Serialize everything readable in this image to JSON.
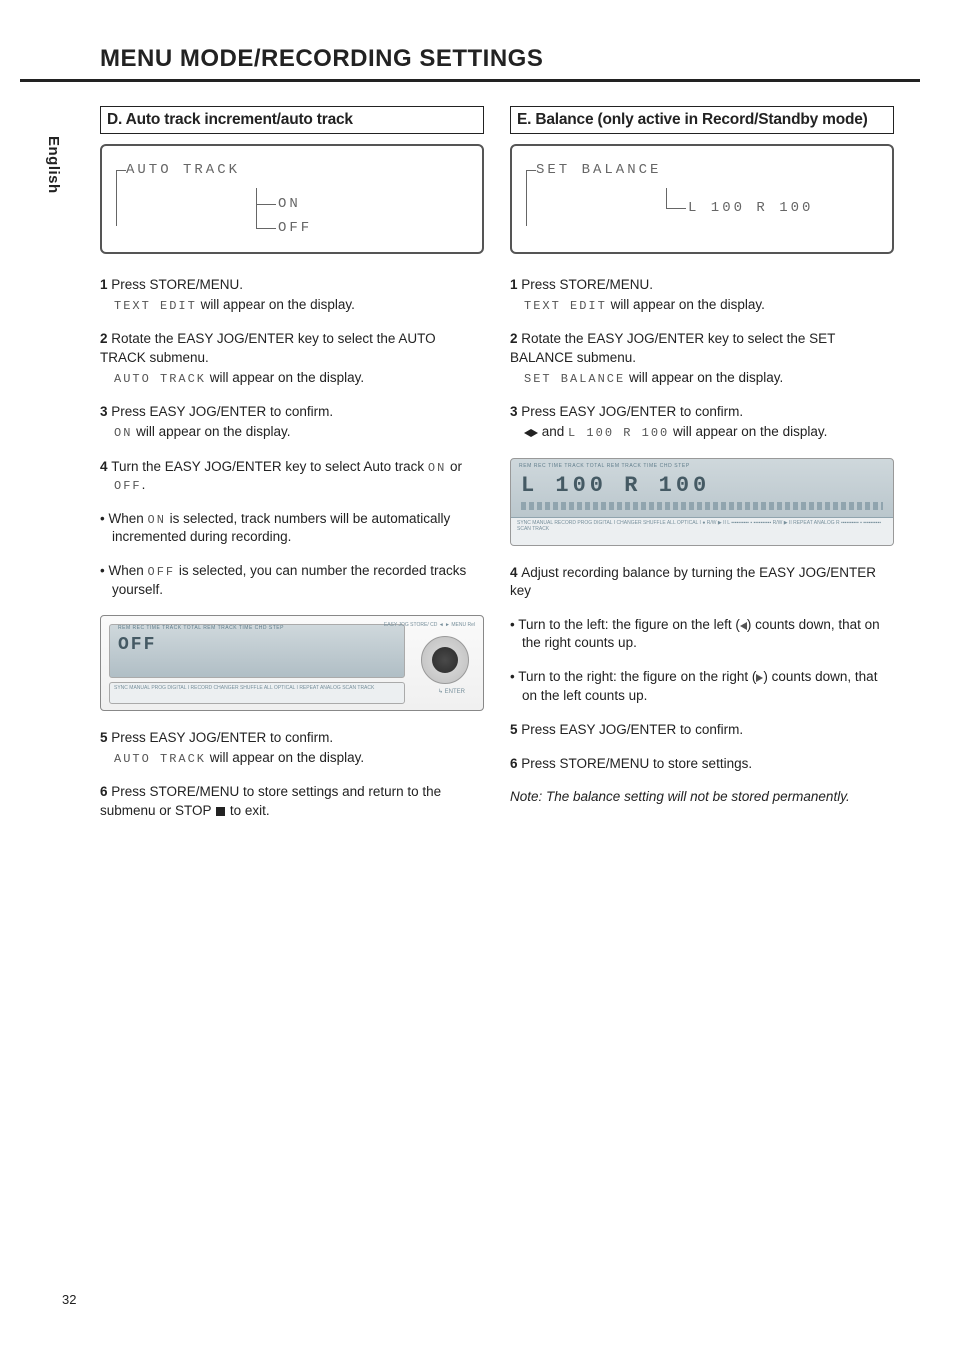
{
  "page": {
    "language_tab": "English",
    "title": "MENU MODE/RECORDING SETTINGS",
    "page_number": "32"
  },
  "left": {
    "section_title": "D. Auto track increment/auto track",
    "display": {
      "top_label": "AUTO TRACK",
      "opt_on": "ON",
      "opt_off": "OFF"
    },
    "steps": {
      "s1_a": "Press STORE/MENU.",
      "s1_b_pre": "TEXT EDIT",
      "s1_b_post": " will appear on the display.",
      "s2_a": "Rotate the EASY JOG/ENTER key to select the AUTO TRACK submenu.",
      "s2_b_pre": "AUTO TRACK",
      "s2_b_post": " will appear on the display.",
      "s3_a": "Press EASY JOG/ENTER to confirm.",
      "s3_b_pre": "ON",
      "s3_b_post": " will appear on the display.",
      "s4_a": "Turn the EASY JOG/ENTER key to select Auto track ",
      "s4_on": "ON",
      "s4_mid": " or ",
      "s4_off": "OFF",
      "s4_end": ".",
      "b1_pre": "When ",
      "b1_on": "ON",
      "b1_post": " is selected, track numbers will be automatically incremented during recording.",
      "b2_pre": "When ",
      "b2_off": "OFF",
      "b2_post": " is selected, you can number the recorded tracks yourself.",
      "s5_a": "Press EASY JOG/ENTER to confirm.",
      "s5_b_pre": "AUTO TRACK",
      "s5_b_post": " will appear on the display.",
      "s6_a": "Press STORE/MENU to store settings and return to the submenu or STOP ",
      "s6_b": " to exit."
    },
    "device": {
      "screen_big": "OFF",
      "screen_top": "REM   REC   TIME  TRACK          TOTAL  REM   TRACK  TIME                    CHD   STEP",
      "strip": "SYNC MANUAL                                                                           PROG\nDIGITAL I                    RECORD     CHANGER                                SHUFFLE   ALL\nOPTICAL I                                                                       REPEAT\nANALOG                                                                          SCAN   TRACK",
      "jog_top": "EASY JOG       STORE/      CD\n  ◄       ►     MENU        Rel",
      "jog_bottom": "↳ ENTER"
    }
  },
  "right": {
    "section_title": "E. Balance (only active in Record/Standby mode)",
    "display": {
      "top_label": "SET BALANCE",
      "value": "L 100 R 100"
    },
    "steps": {
      "s1_a": "Press STORE/MENU.",
      "s1_b_pre": "TEXT EDIT",
      "s1_b_post": " will appear on the display.",
      "s2_a": "Rotate the EASY JOG/ENTER key to select the SET BALANCE submenu.",
      "s2_b_pre": "SET BALANCE",
      "s2_b_post": " will appear on the display.",
      "s3_a": "Press EASY JOG/ENTER to confirm.",
      "s3_b_mid": " and ",
      "s3_b_val": "L 100 R 100",
      "s3_b_post": " will appear on the display.",
      "s4": "Adjust recording balance by turning the EASY JOG/ENTER key",
      "b1_a": "Turn to the left: the figure on the left (",
      "b1_b": ") counts down, that on the right counts up.",
      "b2_a": "Turn to the right: the figure on the right (",
      "b2_b": ") counts down, that on the left counts up.",
      "s5": "Press EASY JOG/ENTER to confirm.",
      "s6": "Press STORE/MENU to store settings."
    },
    "lcd": {
      "toprow": "REM   REC   TIME  TRACK          TOTAL  REM   TRACK  TIME                    CHD   STEP",
      "big": "L 100  R  100",
      "bottom": "SYNC MANUAL                  RECORD                                            PROG\nDIGITAL I                    CHANGER                                SHUFFLE   ALL\nOPTICAL I               ● R/W ▶ II     L ▪▪▪▪▪▪▪▪▪▪ ▪ ▪▪▪▪▪▪▪▪▪▪     R/W ▶ II  REPEAT\nANALOG                                 R ▪▪▪▪▪▪▪▪▪▪ ▪ ▪▪▪▪▪▪▪▪▪▪                SCAN   TRACK"
    },
    "note": "Note: The balance setting will not be stored permanently."
  }
}
